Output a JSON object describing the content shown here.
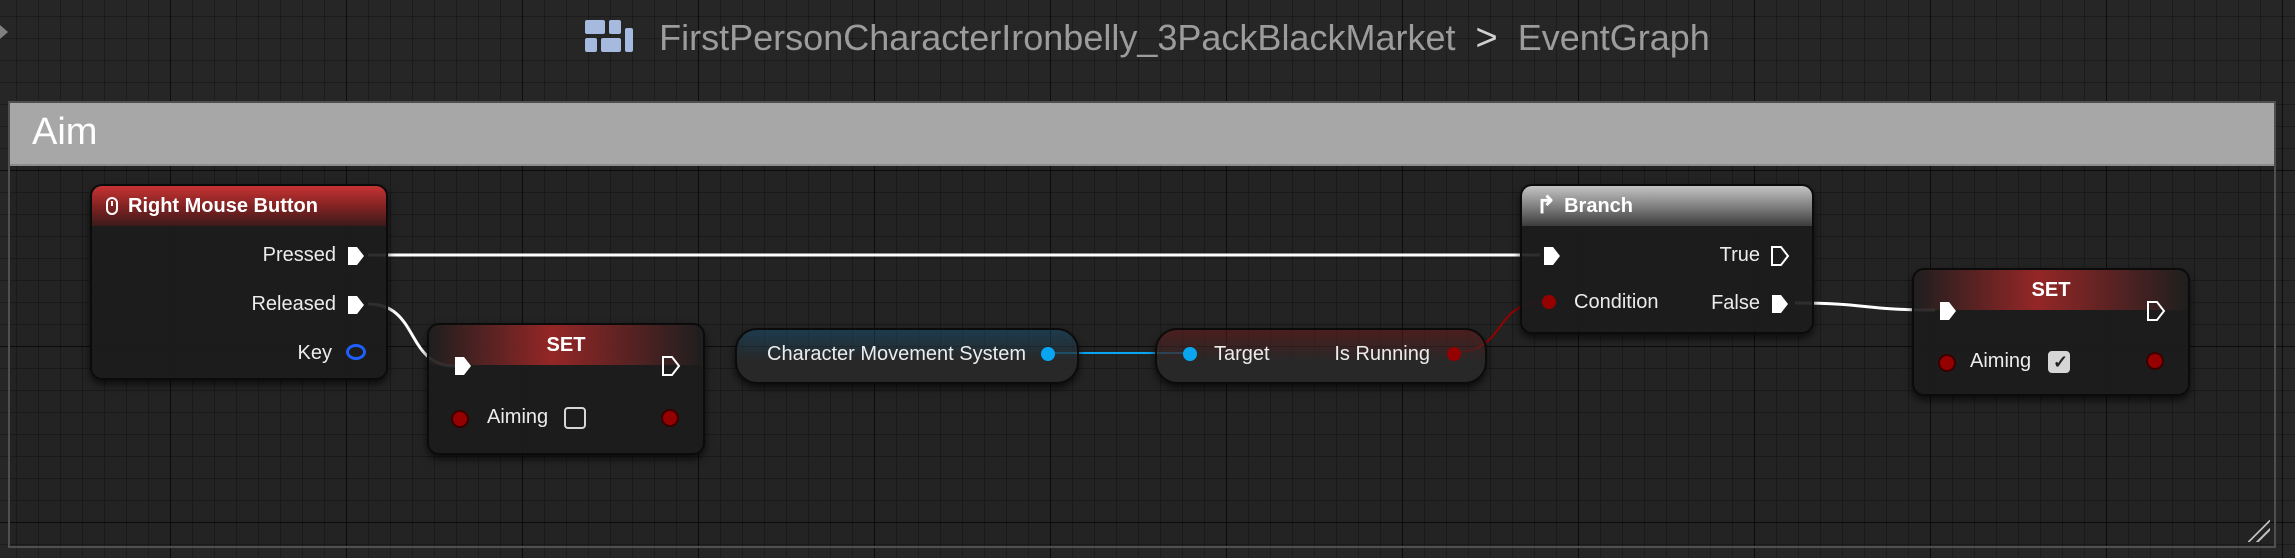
{
  "breadcrumb": {
    "blueprint": "FirstPersonCharacterIronbelly_3PackBlackMarket",
    "separator": ">",
    "graph": "EventGraph"
  },
  "comment": {
    "title": "Aim"
  },
  "nodes": {
    "rmb": {
      "title": "Right Mouse Button",
      "pins": {
        "pressed": "Pressed",
        "released": "Released",
        "key": "Key"
      }
    },
    "set_false": {
      "title": "SET",
      "var_label": "Aiming",
      "checked": false
    },
    "char_move": {
      "title": "Character Movement System"
    },
    "is_running": {
      "target_label": "Target",
      "output_label": "Is Running"
    },
    "branch": {
      "title": "Branch",
      "pins": {
        "condition": "Condition",
        "true_label": "True",
        "false_label": "False"
      }
    },
    "set_true": {
      "title": "SET",
      "var_label": "Aiming",
      "checked": true
    }
  },
  "colors": {
    "exec": "#ffffff",
    "bool_pin": "#950000",
    "object_pin": "#0aa5f0",
    "key_pin": "#1f5fff",
    "event_header": "#c73333",
    "branch_header": "#9a9a9a"
  },
  "icons": [
    "blueprint-icon",
    "mouse-icon",
    "branch-icon",
    "exec-pin-icon",
    "checkbox-icon"
  ]
}
